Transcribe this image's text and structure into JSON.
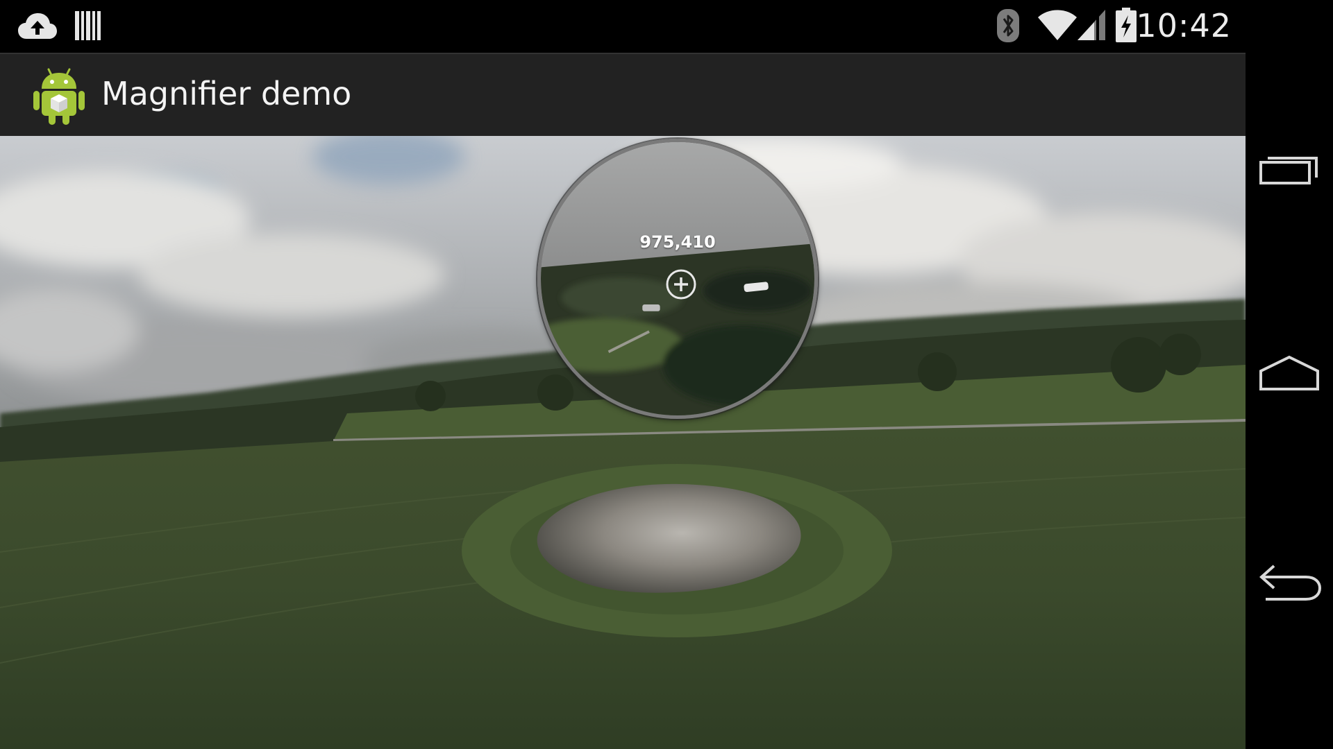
{
  "status_bar": {
    "time": "10:42",
    "left_icons": [
      "upload-cloud-icon",
      "barcode-icon"
    ],
    "right_icons": [
      "bluetooth-icon",
      "wifi-icon",
      "signal-icon",
      "battery-charging-icon"
    ]
  },
  "app": {
    "title": "Magnifier demo",
    "icon": "android-robot-icon"
  },
  "magnifier": {
    "coordinates": "975,410",
    "center_icon": "crosshair-plus-icon"
  },
  "navigation": {
    "buttons": [
      {
        "name": "recent-apps",
        "icon": "recent-apps-icon"
      },
      {
        "name": "home",
        "icon": "home-icon"
      },
      {
        "name": "back",
        "icon": "back-icon"
      }
    ]
  },
  "colors": {
    "status_bar": "#000000",
    "action_bar": "#222222",
    "android_green": "#a4c639",
    "magnifier_border": "#7a7a7a"
  }
}
